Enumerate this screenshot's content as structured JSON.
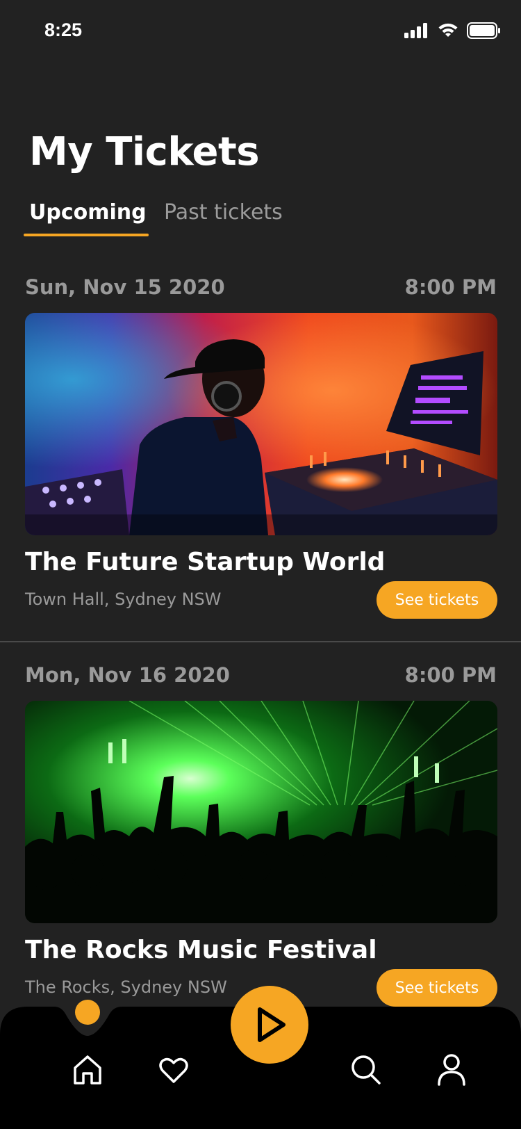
{
  "status_bar": {
    "time": "8:25"
  },
  "page": {
    "title": "My Tickets"
  },
  "tabs": [
    {
      "label": "Upcoming",
      "active": true
    },
    {
      "label": "Past tickets",
      "active": false
    }
  ],
  "events": [
    {
      "date": "Sun, Nov 15 2020",
      "time": "8:00 PM",
      "title": "The Future Startup World",
      "venue": "Town Hall, Sydney NSW",
      "button_label": "See tickets"
    },
    {
      "date": "Mon, Nov 16 2020",
      "time": "8:00 PM",
      "title": "The Rocks Music Festival",
      "venue": "The Rocks, Sydney NSW",
      "button_label": "See tickets"
    }
  ],
  "bottom_nav": {
    "items": [
      "home-icon",
      "heart-icon",
      "play-icon",
      "search-icon",
      "user-icon"
    ]
  },
  "colors": {
    "background": "#222222",
    "accent": "#f6a623",
    "nav_background": "#000000",
    "muted_text": "#9a9a9a"
  }
}
